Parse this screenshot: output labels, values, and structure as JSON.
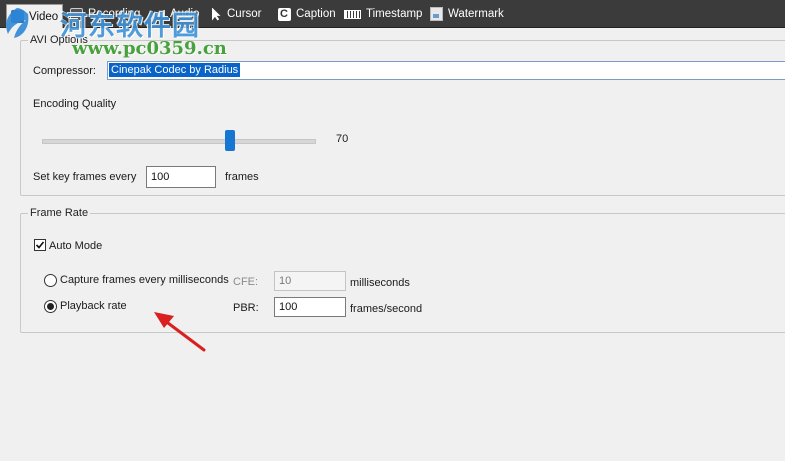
{
  "tabs": [
    {
      "label": "Video",
      "icon": "video-icon"
    },
    {
      "label": "Recording",
      "icon": "record-icon"
    },
    {
      "label": "Audio",
      "icon": "speaker-icon"
    },
    {
      "label": "Cursor",
      "icon": "cursor-icon"
    },
    {
      "label": "Caption",
      "icon": "caption-icon"
    },
    {
      "label": "Timestamp",
      "icon": "ruler-icon"
    },
    {
      "label": "Watermark",
      "icon": "watermark-icon"
    }
  ],
  "active_tab": "Video",
  "watermark_overlay": {
    "site_name": "河东软件园",
    "url": "www.pc0359.cn"
  },
  "avi_options": {
    "title": "AVI Options",
    "compressor_label": "Compressor:",
    "compressor_value": "Cinepak Codec by Radius",
    "quality_label": "Encoding Quality",
    "quality_value": "70",
    "quality_fraction": 0.7,
    "keyframes_label": "Set key frames every",
    "keyframes_value": "100",
    "keyframes_unit": "frames"
  },
  "frame_rate": {
    "title": "Frame Rate",
    "auto_mode_label": "Auto Mode",
    "auto_mode_checked": true,
    "capture_label": "Capture frames every milliseconds",
    "cfe_label": "CFE:",
    "cfe_value": "10",
    "cfe_unit": "milliseconds",
    "playback_label": "Playback rate",
    "pbr_label": "PBR:",
    "pbr_value": "100",
    "pbr_unit": "frames/second",
    "selected": "playback"
  },
  "colors": {
    "accent": "#1676d2",
    "tab_bar": "#3b3b3b",
    "annotation_arrow": "#d91f1f"
  }
}
